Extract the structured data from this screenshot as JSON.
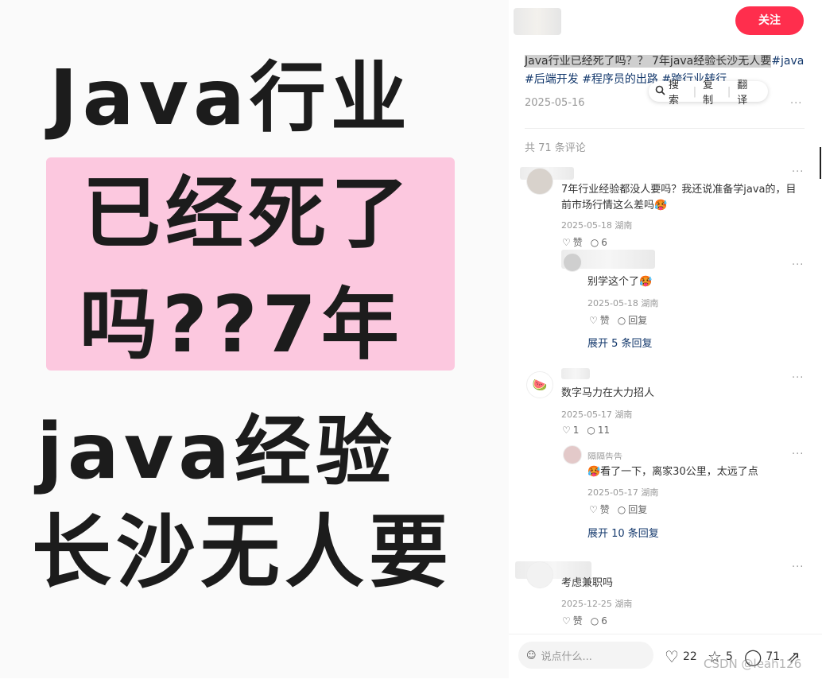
{
  "cover": {
    "line1": "Java行业",
    "line2": "已经死了",
    "line3": "吗??7年",
    "line4": "java经验",
    "line5": "长沙无人要"
  },
  "header": {
    "follow_label": "关注"
  },
  "post": {
    "title_highlight": "Java行业已经死了吗？？ 7年java经验长沙无人要",
    "tag1": "#java",
    "tag2": "#后端开发",
    "tag3": "#程序员的出路",
    "tag4": "#跨行业转行",
    "date": "2025-05-16",
    "more": "···"
  },
  "selection_popup": {
    "search": "搜索",
    "copy": "复制",
    "translate": "翻译",
    "search_icon": "search-icon"
  },
  "comments_count": "共 71 条评论",
  "comments": [
    {
      "text": "7年行业经验都没人要吗？我还说准备学java的，目前市场行情这么差吗🥵",
      "date": "2025-05-18 湖南",
      "like": "赞",
      "reply_count": "6",
      "reply": {
        "text": "别学这个了🥵",
        "date": "2025-05-18 湖南",
        "like": "赞",
        "reply": "回复"
      },
      "expand": "展开 5 条回复"
    },
    {
      "text": "数字马力在大力招人",
      "date": "2025-05-17 湖南",
      "like": "1",
      "reply_count": "11",
      "reply": {
        "text": "🥵看了一下，离家30公里，太远了点",
        "date": "2025-05-17 湖南",
        "like": "赞",
        "reply": "回复",
        "author_partial": "隔隔告告"
      },
      "expand": "展开 10 条回复"
    },
    {
      "text": "考虑兼职吗",
      "date": "2025-12-25 湖南",
      "like": "赞",
      "reply_count": "6"
    }
  ],
  "bottom_bar": {
    "placeholder": "说点什么...",
    "likes": "22",
    "stars": "5",
    "comments": "71"
  },
  "watermark": "CSDN @leah126",
  "colors": {
    "accent": "#ff2e4d",
    "tag": "#13386c",
    "pink": "#fcc8df"
  }
}
